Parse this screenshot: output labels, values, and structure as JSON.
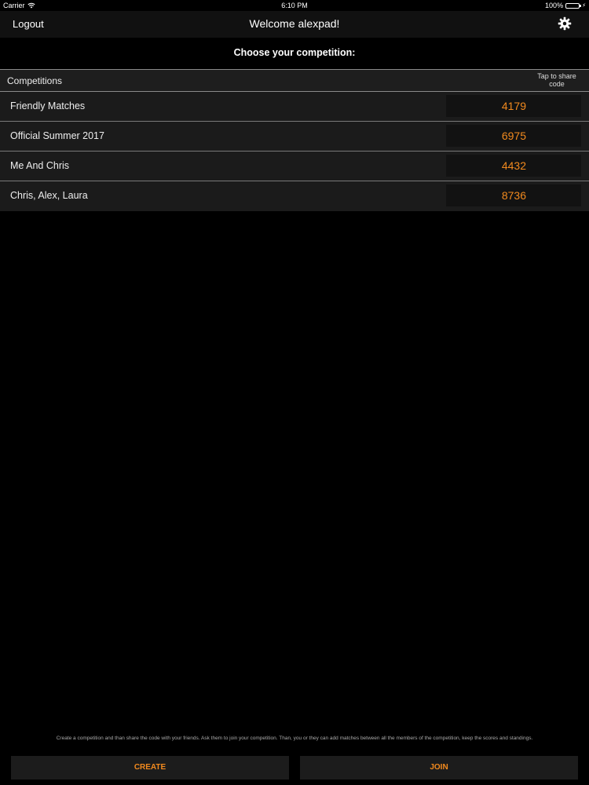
{
  "status_bar": {
    "carrier": "Carrier",
    "wifi_icon": "wifi-icon",
    "time": "6:10 PM",
    "battery": "100%",
    "battery_level": 100
  },
  "nav": {
    "logout_label": "Logout",
    "title": "Welcome alexpad!",
    "settings_icon": "gear-icon"
  },
  "subheader": "Choose your competition:",
  "section": {
    "label": "Competitions",
    "hint": "Tap to share code"
  },
  "competitions": [
    {
      "name": "Friendly Matches",
      "code": "4179"
    },
    {
      "name": "Official Summer 2017",
      "code": "6975"
    },
    {
      "name": "Me And Chris",
      "code": "4432"
    },
    {
      "name": "Chris, Alex, Laura",
      "code": "8736"
    }
  ],
  "help_text": "Create a competition and than share the code with your friends. Ask them to join your competition. Than, you or they can add matches between all the members of the competition, keep the scores and standings.",
  "buttons": {
    "create": "CREATE",
    "join": "JOIN"
  },
  "colors": {
    "accent": "#f28a1e",
    "battery": "#4cd964"
  }
}
